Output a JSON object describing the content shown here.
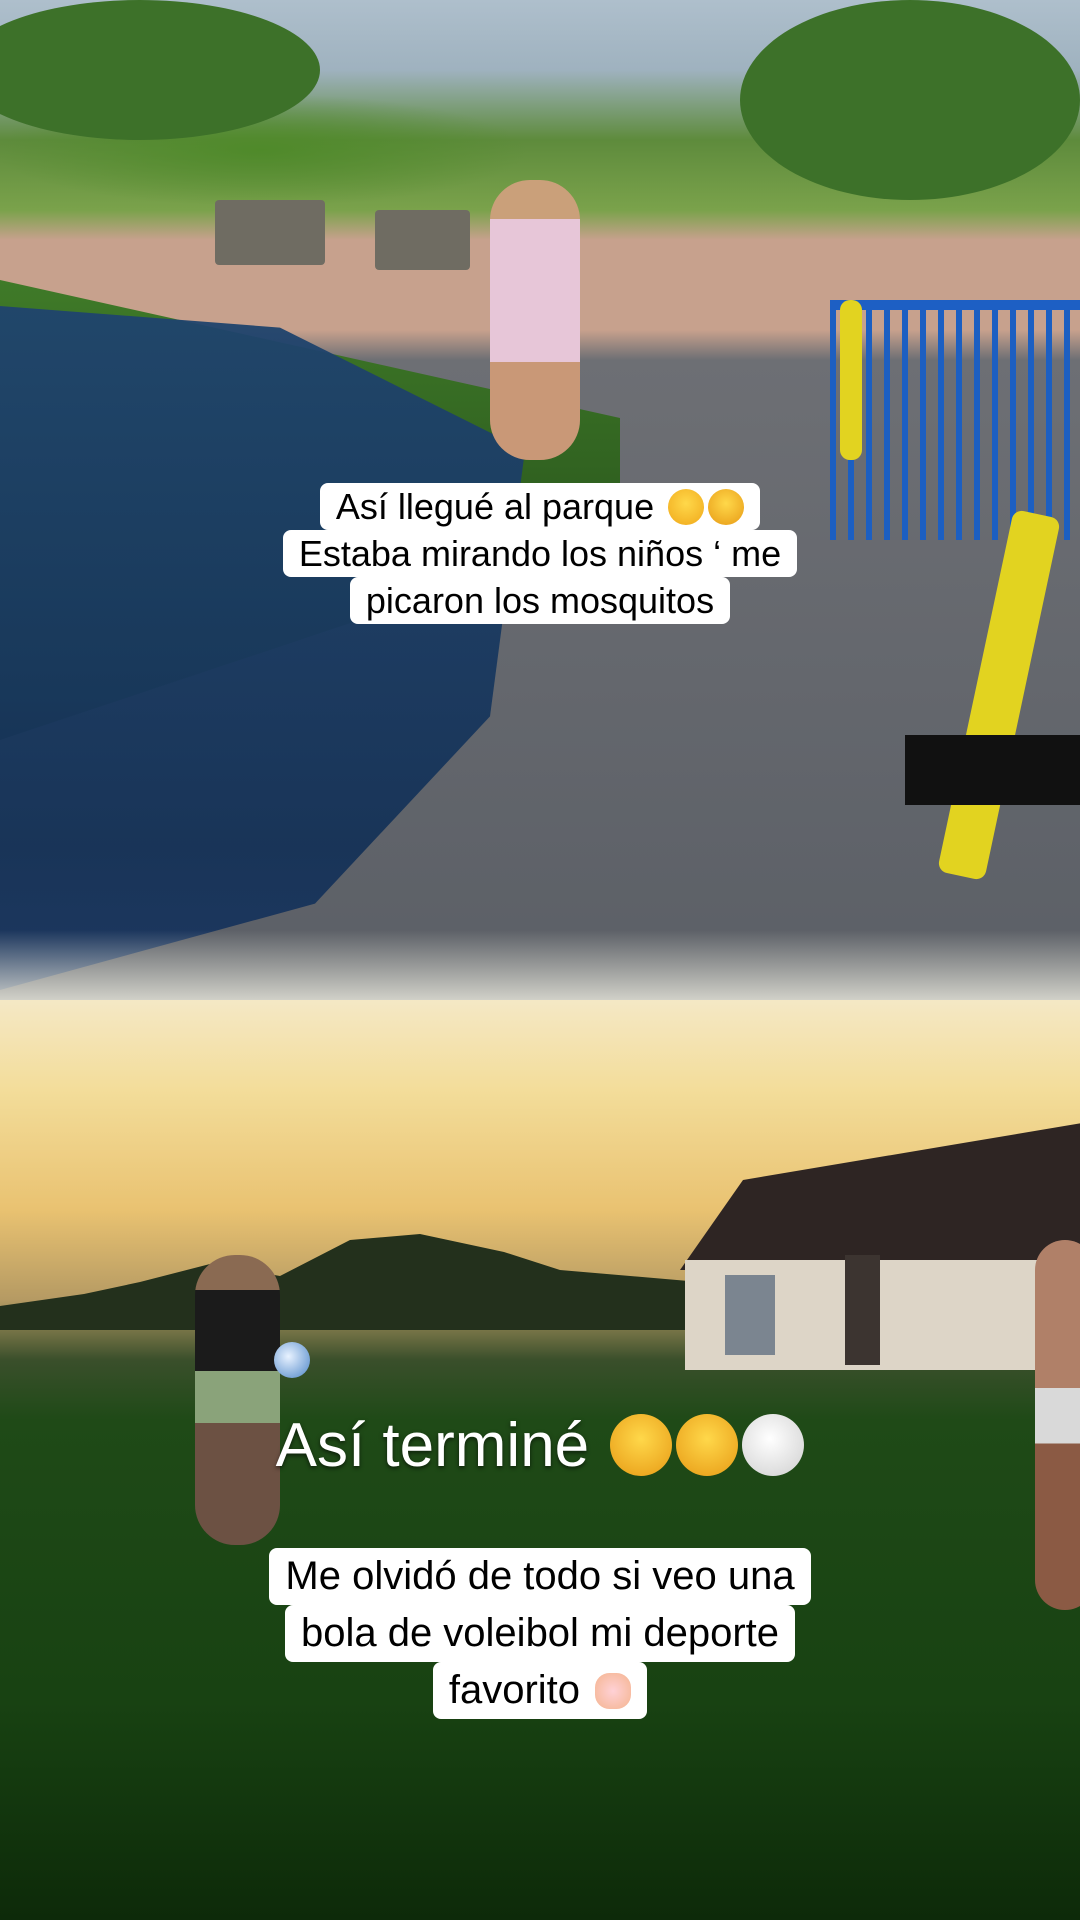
{
  "captions": {
    "top": {
      "line1": "Así llegué al parque",
      "line2": "Estaba mirando los niños ‘ me",
      "line3": "picaron los mosquitos",
      "emojis": [
        "joy-emoji",
        "weary-emoji"
      ]
    },
    "middle": {
      "text": "Así terminé",
      "emojis": [
        "weary-emoji",
        "wink-emoji",
        "white-circle-emoji"
      ]
    },
    "bottom": {
      "line1": "Me olvidó de todo si veo una",
      "line2": "bola de  voleibol mi deporte",
      "line3": "favorito",
      "emojis": [
        "heart-hands-emoji"
      ]
    }
  },
  "colors": {
    "caption_bg": "#ffffff",
    "caption_text": "#000000",
    "overlay_text": "#ffffff"
  }
}
